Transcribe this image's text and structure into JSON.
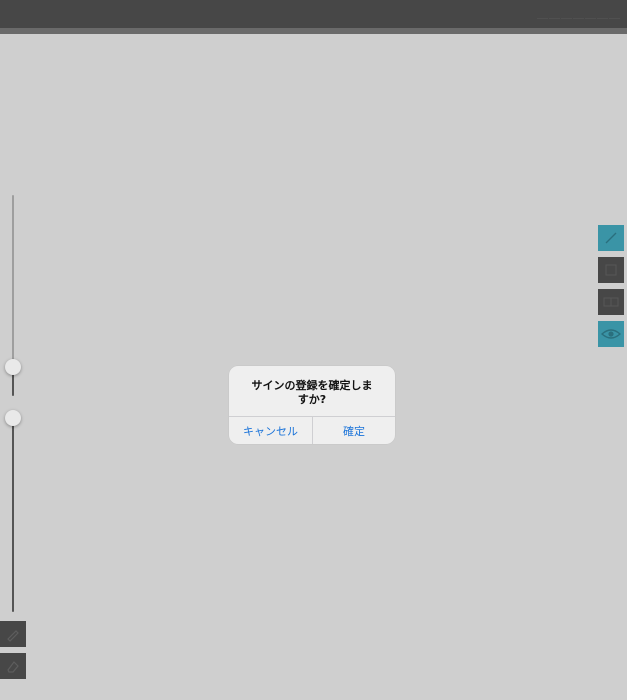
{
  "topbar": {
    "title": "＿＿＿＿＿＿＿"
  },
  "left_tools": {
    "sliders": [
      {
        "name": "brush-size",
        "value_fraction": 0.0
      },
      {
        "name": "brush-opacity",
        "value_fraction": 1.0
      }
    ],
    "buttons": [
      {
        "icon": "pen-icon"
      },
      {
        "icon": "eraser-icon"
      }
    ]
  },
  "right_tools": {
    "buttons": [
      {
        "icon": "pen-icon",
        "active": true
      },
      {
        "icon": "square-icon",
        "active": false
      },
      {
        "icon": "grid-icon",
        "active": false
      },
      {
        "icon": "eye-icon",
        "active": true
      }
    ]
  },
  "alert": {
    "message": "サインの登録を確定しますか?",
    "cancel_label": "キャンセル",
    "confirm_label": "確定"
  },
  "colors": {
    "topbar": "#474747",
    "canvas": "#cfcfcf",
    "accent": "#3a94a6",
    "button_dark": "#474747",
    "link_blue": "#1a73d9"
  }
}
